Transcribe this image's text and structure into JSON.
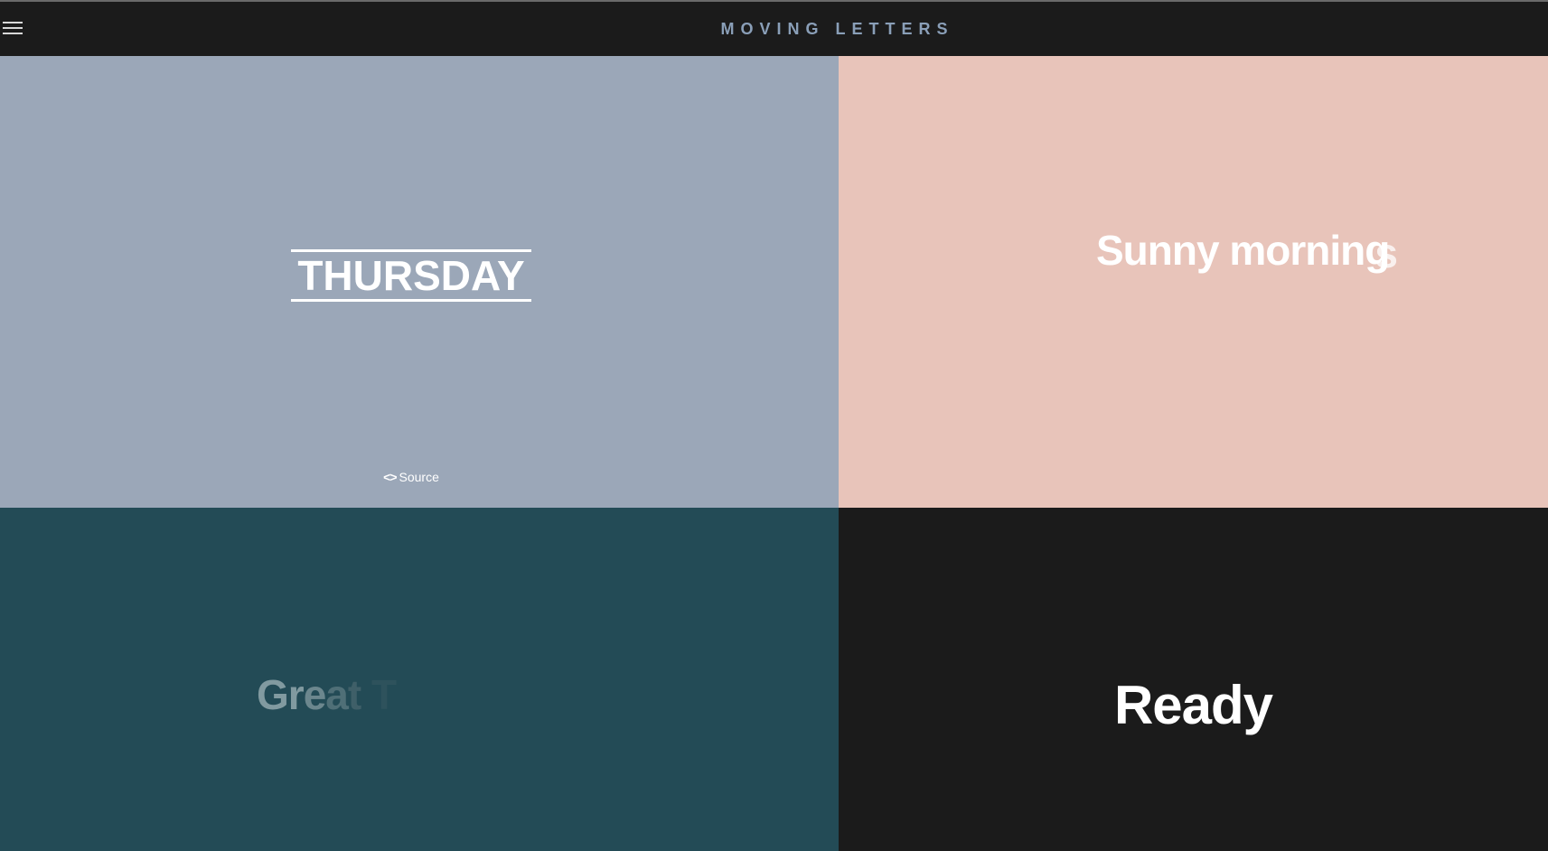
{
  "header": {
    "title": "MOVING LETTERS",
    "menu_icon": "hamburger-menu-icon"
  },
  "panels": {
    "thursday": {
      "text": "THURSDAY",
      "background": "#9ba7b8",
      "source_label": "Source",
      "source_icon": "code-icon"
    },
    "sunny": {
      "text": "Sunny mornings",
      "background": "#e8c4ba"
    },
    "great": {
      "letters": [
        "Gr",
        "e",
        "a",
        "t",
        " T"
      ],
      "background": "#234b56"
    },
    "ready": {
      "text": "Ready",
      "background": "#1b1b1b"
    }
  }
}
